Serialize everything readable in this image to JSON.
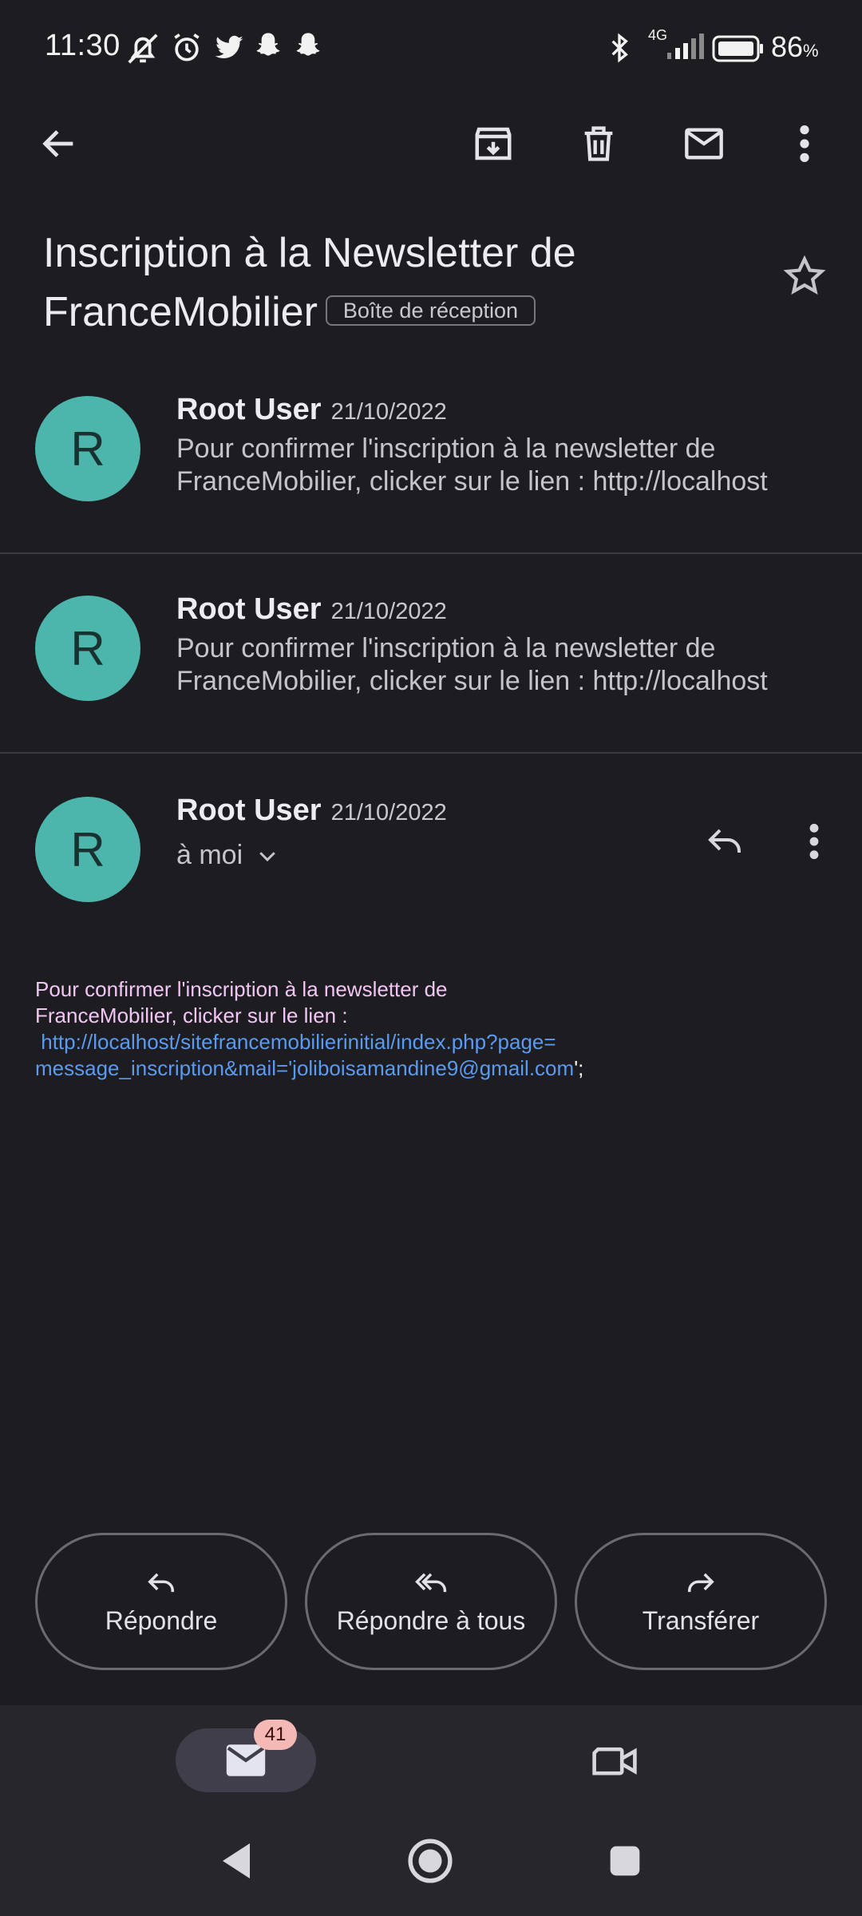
{
  "status_bar": {
    "time": "11:30",
    "network": "4G",
    "battery": "86",
    "battery_unit": "%",
    "icons": [
      "bell-muted-icon",
      "alarm-icon",
      "twitter-icon",
      "snapchat-icon",
      "snapchat-icon",
      "bluetooth-icon",
      "signal-icon",
      "battery-icon"
    ]
  },
  "toolbar": {
    "icons": [
      "back-arrow-icon",
      "archive-icon",
      "delete-icon",
      "mark-unread-icon",
      "more-vert-icon"
    ]
  },
  "email": {
    "subject_line1": "Inscription à la Newsletter de",
    "subject_line2": "FranceMobilier",
    "label": "Boîte de réception"
  },
  "messages": [
    {
      "avatar_letter": "R",
      "sender": "Root User",
      "date": "21/10/2022",
      "snippet_line1": "Pour confirmer l'inscription à la newsletter de",
      "snippet_line2": "FranceMobilier, clicker sur le lien : http://localhost"
    },
    {
      "avatar_letter": "R",
      "sender": "Root User",
      "date": "21/10/2022",
      "snippet_line1": "Pour confirmer l'inscription à la newsletter de",
      "snippet_line2": "FranceMobilier, clicker sur le lien : http://localhost"
    }
  ],
  "open_message": {
    "avatar_letter": "R",
    "sender": "Root User",
    "date": "21/10/2022",
    "recipient": "à moi",
    "body_line1": "Pour confirmer l'inscription à la newsletter de",
    "body_line2": "FranceMobilier, clicker sur le lien :",
    "link_line1": "http://localhost/sitefrancemobilierinitial/index.php?page=",
    "link_line2": "message_inscription&mail='joliboisamandine9@gmail.com",
    "link_suffix": "';"
  },
  "actions": {
    "reply": "Répondre",
    "reply_all": "Répondre à tous",
    "forward": "Transférer"
  },
  "bottom_nav": {
    "mail_badge": "41"
  },
  "colors": {
    "background": "#1d1c21",
    "avatar": "#4db6ac",
    "body_text": "#f1c6f3",
    "link": "#5a9bf0",
    "badge": "#f4b9b5"
  }
}
